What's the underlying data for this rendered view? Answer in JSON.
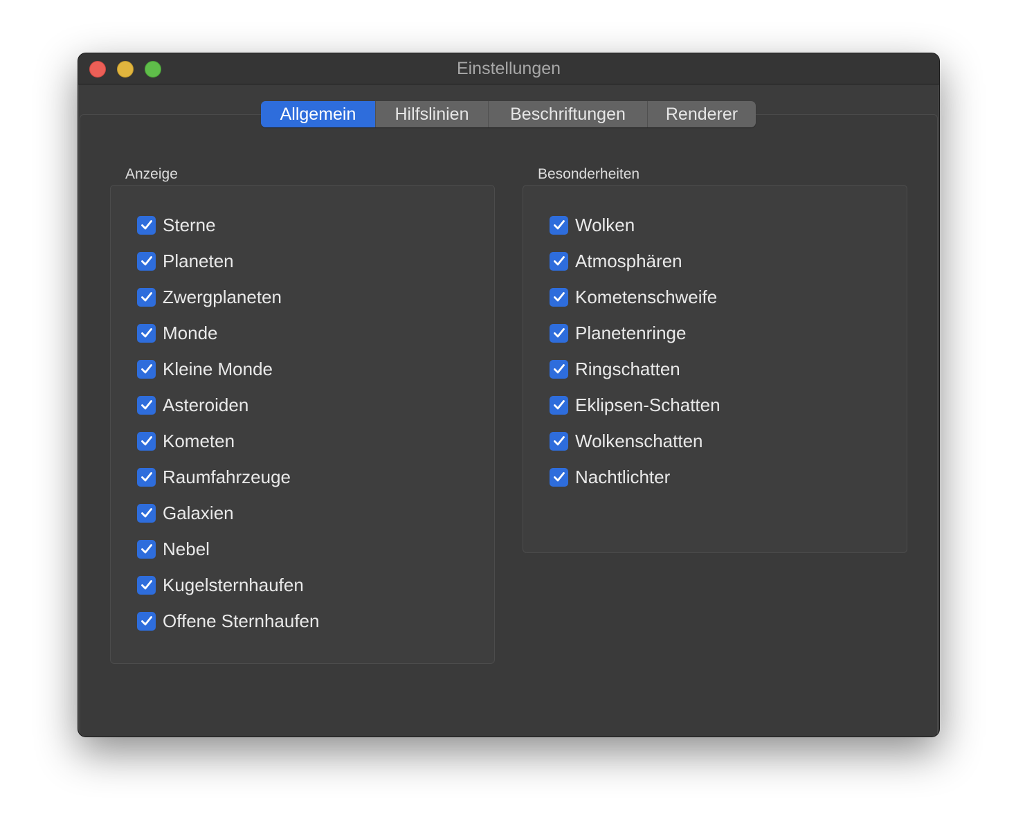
{
  "window": {
    "title": "Einstellungen"
  },
  "tabs": [
    {
      "label": "Allgemein",
      "selected": true
    },
    {
      "label": "Hilfslinien",
      "selected": false
    },
    {
      "label": "Beschriftungen",
      "selected": false
    },
    {
      "label": "Renderer",
      "selected": false
    }
  ],
  "groups": {
    "anzeige": {
      "label": "Anzeige",
      "items": [
        {
          "label": "Sterne",
          "checked": true
        },
        {
          "label": "Planeten",
          "checked": true
        },
        {
          "label": "Zwergplaneten",
          "checked": true
        },
        {
          "label": "Monde",
          "checked": true
        },
        {
          "label": "Kleine Monde",
          "checked": true
        },
        {
          "label": "Asteroiden",
          "checked": true
        },
        {
          "label": "Kometen",
          "checked": true
        },
        {
          "label": "Raumfahrzeuge",
          "checked": true
        },
        {
          "label": "Galaxien",
          "checked": true
        },
        {
          "label": "Nebel",
          "checked": true
        },
        {
          "label": "Kugelsternhaufen",
          "checked": true
        },
        {
          "label": "Offene Sternhaufen",
          "checked": true
        }
      ]
    },
    "besonderheiten": {
      "label": "Besonderheiten",
      "items": [
        {
          "label": "Wolken",
          "checked": true
        },
        {
          "label": "Atmosphären",
          "checked": true
        },
        {
          "label": "Kometenschweife",
          "checked": true
        },
        {
          "label": "Planetenringe",
          "checked": true
        },
        {
          "label": "Ringschatten",
          "checked": true
        },
        {
          "label": "Eklipsen-Schatten",
          "checked": true
        },
        {
          "label": "Wolkenschatten",
          "checked": true
        },
        {
          "label": "Nachtlichter",
          "checked": true
        }
      ]
    }
  },
  "colors": {
    "accent": "#2e6ddc",
    "window_bg": "#3c3c3c"
  },
  "icons": {
    "checkbox": "checkmark-icon"
  }
}
